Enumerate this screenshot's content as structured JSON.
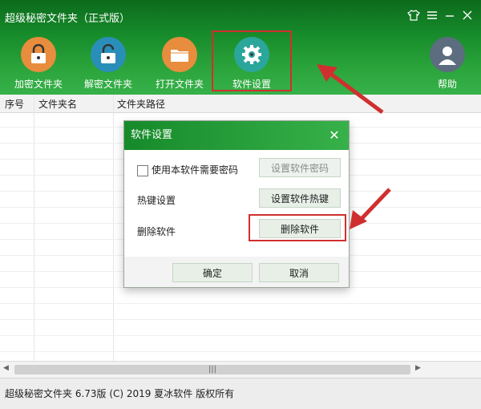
{
  "window": {
    "title": "超级秘密文件夹（正式版）",
    "controls": [
      "shirt-icon",
      "menu-icon",
      "minimize-icon",
      "close-icon"
    ]
  },
  "toolbar": {
    "buttons": [
      {
        "label": "加密文件夹",
        "icon": "lock-icon",
        "color": "#e78d3d"
      },
      {
        "label": "解密文件夹",
        "icon": "unlock-icon",
        "color": "#2a8fb8"
      },
      {
        "label": "打开文件夹",
        "icon": "folder-icon",
        "color": "#e78d3d"
      },
      {
        "label": "软件设置",
        "icon": "gear-icon",
        "color": "#2ba69b"
      }
    ],
    "help": {
      "label": "帮助",
      "icon": "user-icon",
      "color": "#5b6d7e"
    }
  },
  "list": {
    "columns": [
      "序号",
      "文件夹名",
      "文件夹路径"
    ]
  },
  "dialog": {
    "title": "软件设置",
    "close_icon": "close-icon",
    "rows": [
      {
        "label": "使用本软件需要密码",
        "button": "设置软件密码",
        "checkbox": true
      },
      {
        "label": "热键设置",
        "button": "设置软件热键"
      },
      {
        "label": "删除软件",
        "button": "删除软件"
      }
    ],
    "ok_label": "确定",
    "cancel_label": "取消"
  },
  "scrollbar": {
    "thumb_label": "|||"
  },
  "status": {
    "text": "超级秘密文件夹 6.73版 (C) 2019 夏冰软件 版权所有"
  },
  "annotation_color": "#d02f2f"
}
